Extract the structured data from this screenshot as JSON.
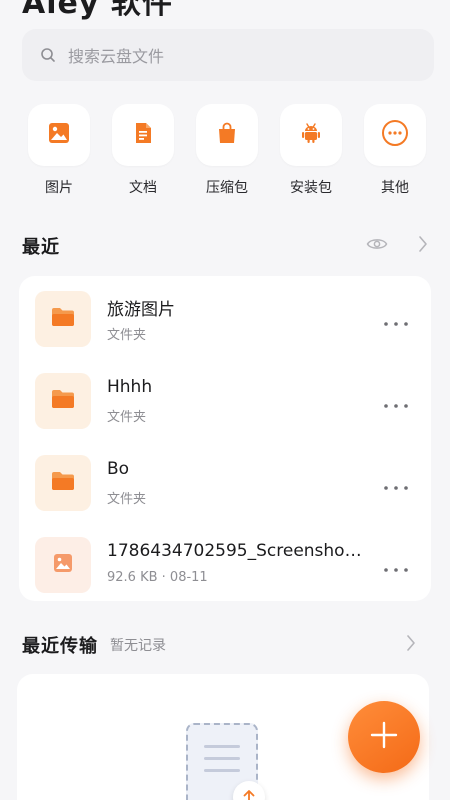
{
  "app": {
    "title": "Aley 软件"
  },
  "search": {
    "placeholder": "搜索云盘文件"
  },
  "colors": {
    "accent": "#f47a25",
    "background": "#f6f6f8",
    "card": "#ffffff",
    "folder_thumb_bg": "#fdf0e2",
    "muted_text": "#8e8e93"
  },
  "categories": [
    {
      "label": "图片",
      "icon": "image-icon"
    },
    {
      "label": "文档",
      "icon": "document-icon"
    },
    {
      "label": "压缩包",
      "icon": "bag-icon"
    },
    {
      "label": "安装包",
      "icon": "android-icon"
    },
    {
      "label": "其他",
      "icon": "more-circle-icon"
    }
  ],
  "recent": {
    "title": "最近",
    "icons": [
      "eye-icon",
      "chevron-right-icon"
    ],
    "items": [
      {
        "name": "旅游图片",
        "meta": "文件夹",
        "icon": "folder-icon"
      },
      {
        "name": "Hhhh",
        "meta": "文件夹",
        "icon": "folder-icon"
      },
      {
        "name": "Bo",
        "meta": "文件夹",
        "icon": "folder-icon"
      },
      {
        "name": "1786434702595_Screenshot...",
        "meta": "92.6 KB · 08-11",
        "icon": "image-file-icon"
      }
    ]
  },
  "transfer": {
    "title": "最近传输",
    "subtitle": "暂无记录"
  },
  "fab": {
    "icon": "plus-icon"
  }
}
